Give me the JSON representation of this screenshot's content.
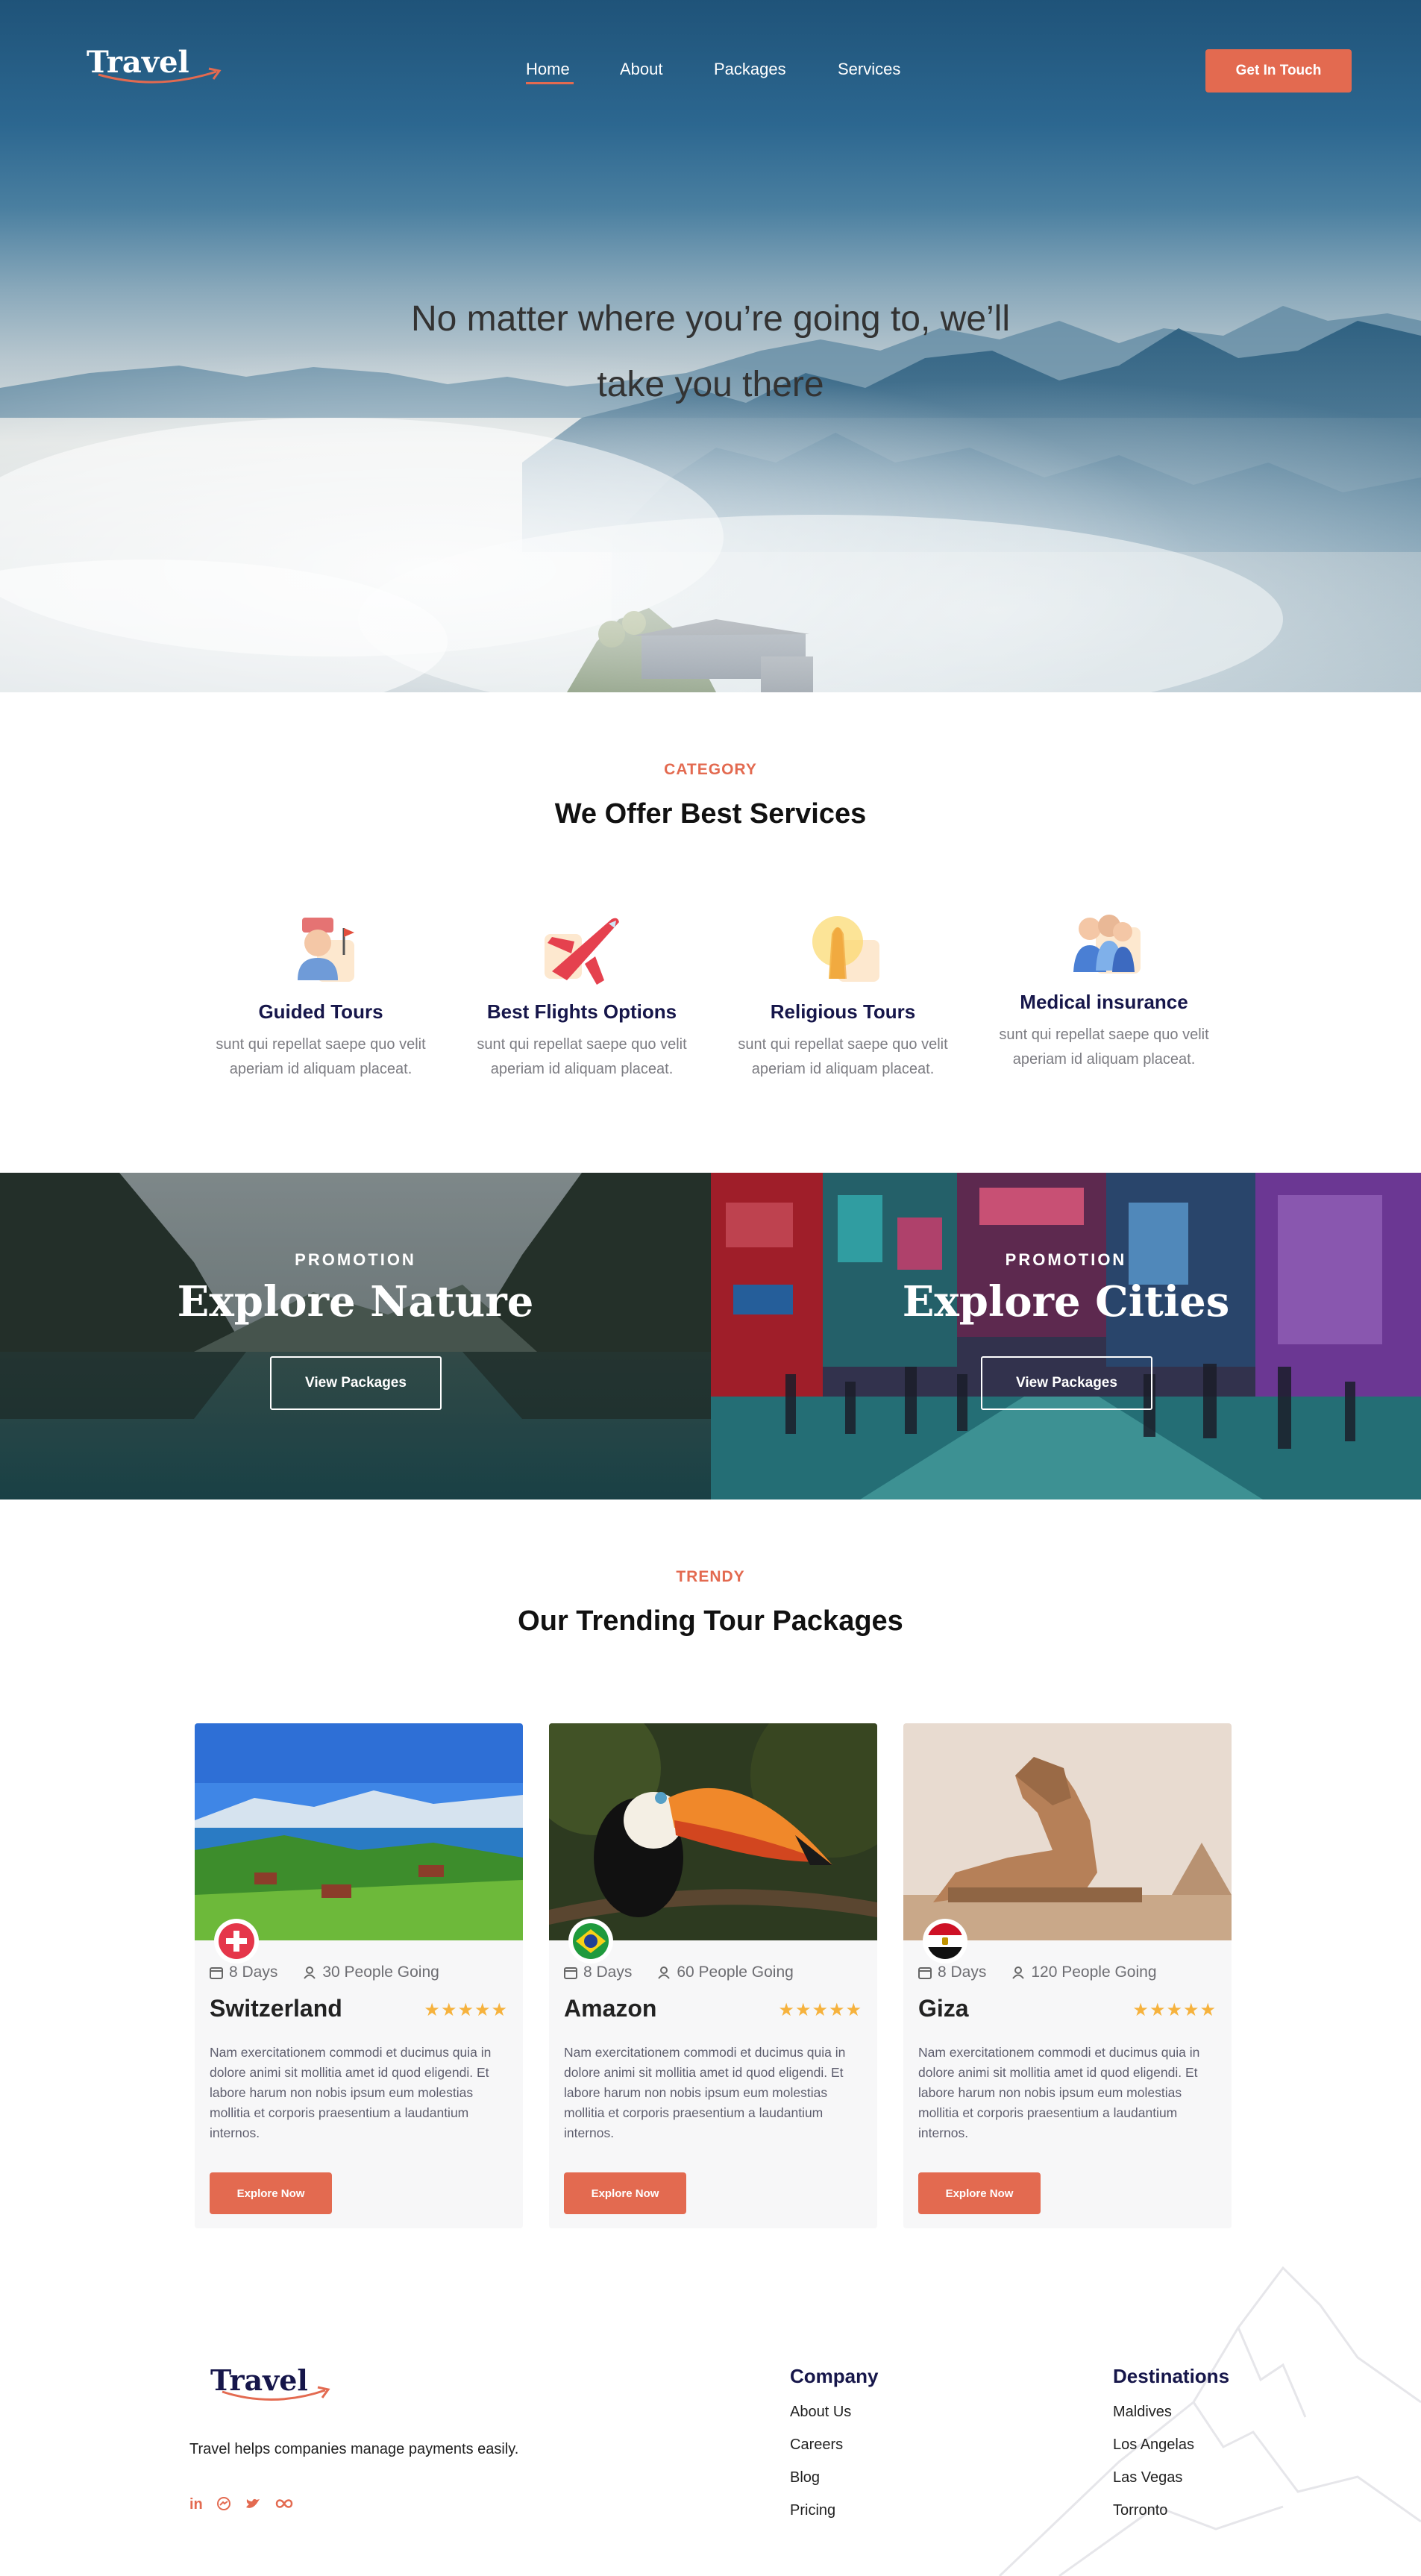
{
  "brand": {
    "logo": "Travel",
    "accent": "#e36a50",
    "navy": "#16164a"
  },
  "nav": {
    "items": [
      "Home",
      "About",
      "Packages",
      "Services"
    ],
    "active": "Home",
    "cta": "Get In Touch"
  },
  "hero": {
    "headline_line1": "No matter where you’re going to, we’ll",
    "headline_line2": "take you there"
  },
  "services": {
    "eyebrow": "CATEGORY",
    "title": "We Offer Best Services",
    "items": [
      {
        "icon": "guide-icon",
        "title": "Guided Tours",
        "desc": "sunt qui repellat saepe quo velit aperiam id aliquam placeat."
      },
      {
        "icon": "airplane-icon",
        "title": "Best Flights Options",
        "desc": "sunt qui repellat saepe quo velit aperiam id aliquam placeat."
      },
      {
        "icon": "praying-hands-icon",
        "title": "Religious Tours",
        "desc": "sunt qui repellat saepe quo velit aperiam id aliquam placeat."
      },
      {
        "icon": "medical-team-icon",
        "title": "Medical insurance",
        "desc": "sunt qui repellat saepe quo velit aperiam id aliquam placeat."
      }
    ]
  },
  "promos": [
    {
      "label": "PROMOTION",
      "title": "Explore Nature",
      "button": "View Packages"
    },
    {
      "label": "PROMOTION",
      "title": "Explore Cities",
      "button": "View Packages"
    }
  ],
  "packages": {
    "eyebrow": "TRENDY",
    "title": "Our Trending Tour Packages",
    "items": [
      {
        "name": "Switzerland",
        "flag": "switzerland-flag-icon",
        "days": "8 Days",
        "people": "30 People Going",
        "rating": 5,
        "desc": "Nam exercitationem commodi et ducimus quia in dolore animi sit mollitia amet id quod eligendi. Et labore harum non nobis ipsum eum molestias mollitia et corporis praesentium a laudantium internos.",
        "button": "Explore Now"
      },
      {
        "name": "Amazon",
        "flag": "brazil-flag-icon",
        "days": "8 Days",
        "people": "60 People Going",
        "rating": 5,
        "desc": "Nam exercitationem commodi et ducimus quia in dolore animi sit mollitia amet id quod eligendi. Et labore harum non nobis ipsum eum molestias mollitia et corporis praesentium a laudantium internos.",
        "button": "Explore Now"
      },
      {
        "name": "Giza",
        "flag": "egypt-flag-icon",
        "days": "8 Days",
        "people": "120 People Going",
        "rating": 5,
        "desc": "Nam exercitationem commodi et ducimus quia in dolore animi sit mollitia amet id quod eligendi. Et labore harum non nobis ipsum eum molestias mollitia et corporis praesentium a laudantium internos.",
        "button": "Explore Now"
      }
    ]
  },
  "footer": {
    "logo": "Travel",
    "tagline": "Travel helps companies manage payments easily.",
    "social": [
      "linkedin-icon",
      "messenger-icon",
      "twitter-icon",
      "infinity-icon"
    ],
    "company": {
      "title": "Company",
      "links": [
        "About Us",
        "Careers",
        "Blog",
        "Pricing"
      ]
    },
    "destinations": {
      "title": "Destinations",
      "links": [
        "Maldives",
        "Los Angelas",
        "Las Vegas",
        "Torronto"
      ]
    }
  }
}
